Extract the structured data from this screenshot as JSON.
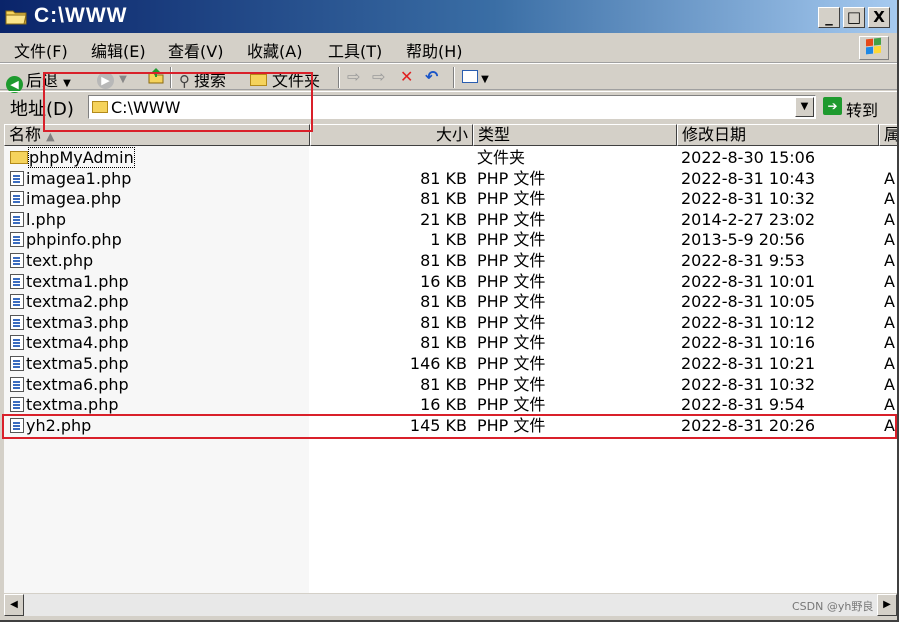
{
  "window": {
    "title": "C:\\WWW",
    "minimize": "_",
    "maximize": "□",
    "close": "X"
  },
  "menu": [
    "文件(F)",
    "编辑(E)",
    "查看(V)",
    "收藏(A)",
    "工具(T)",
    "帮助(H)"
  ],
  "toolbar": {
    "back": "后退",
    "search": "搜索",
    "folders": "文件夹"
  },
  "address": {
    "label": "地址(D)",
    "value": "C:\\WWW",
    "go": "转到"
  },
  "columns": {
    "name": "名称",
    "size": "大小",
    "type": "类型",
    "modified": "修改日期",
    "attr": "属"
  },
  "files": [
    {
      "name": "phpMyAdmin",
      "size": "",
      "type": "文件夹",
      "date": "2022-8-30 15:06",
      "attr": "",
      "folder": true
    },
    {
      "name": "imagea1.php",
      "size": "81 KB",
      "type": "PHP 文件",
      "date": "2022-8-31 10:43",
      "attr": "A"
    },
    {
      "name": "imagea.php",
      "size": "81 KB",
      "type": "PHP 文件",
      "date": "2022-8-31 10:32",
      "attr": "A"
    },
    {
      "name": "l.php",
      "size": "21 KB",
      "type": "PHP 文件",
      "date": "2014-2-27 23:02",
      "attr": "A"
    },
    {
      "name": "phpinfo.php",
      "size": "1 KB",
      "type": "PHP 文件",
      "date": "2013-5-9 20:56",
      "attr": "A"
    },
    {
      "name": "text.php",
      "size": "81 KB",
      "type": "PHP 文件",
      "date": "2022-8-31 9:53",
      "attr": "A"
    },
    {
      "name": "textma1.php",
      "size": "16 KB",
      "type": "PHP 文件",
      "date": "2022-8-31 10:01",
      "attr": "A"
    },
    {
      "name": "textma2.php",
      "size": "81 KB",
      "type": "PHP 文件",
      "date": "2022-8-31 10:05",
      "attr": "A"
    },
    {
      "name": "textma3.php",
      "size": "81 KB",
      "type": "PHP 文件",
      "date": "2022-8-31 10:12",
      "attr": "A"
    },
    {
      "name": "textma4.php",
      "size": "81 KB",
      "type": "PHP 文件",
      "date": "2022-8-31 10:16",
      "attr": "A"
    },
    {
      "name": "textma5.php",
      "size": "146 KB",
      "type": "PHP 文件",
      "date": "2022-8-31 10:21",
      "attr": "A"
    },
    {
      "name": "textma6.php",
      "size": "81 KB",
      "type": "PHP 文件",
      "date": "2022-8-31 10:32",
      "attr": "A"
    },
    {
      "name": "textma.php",
      "size": "16 KB",
      "type": "PHP 文件",
      "date": "2022-8-31 9:54",
      "attr": "A"
    },
    {
      "name": "yh2.php",
      "size": "145 KB",
      "type": "PHP 文件",
      "date": "2022-8-31 20:26",
      "attr": "A"
    }
  ],
  "watermark": "CSDN @yh野良",
  "colors": {
    "annotation": "#d9202a",
    "titlebar": "#0a246a"
  }
}
